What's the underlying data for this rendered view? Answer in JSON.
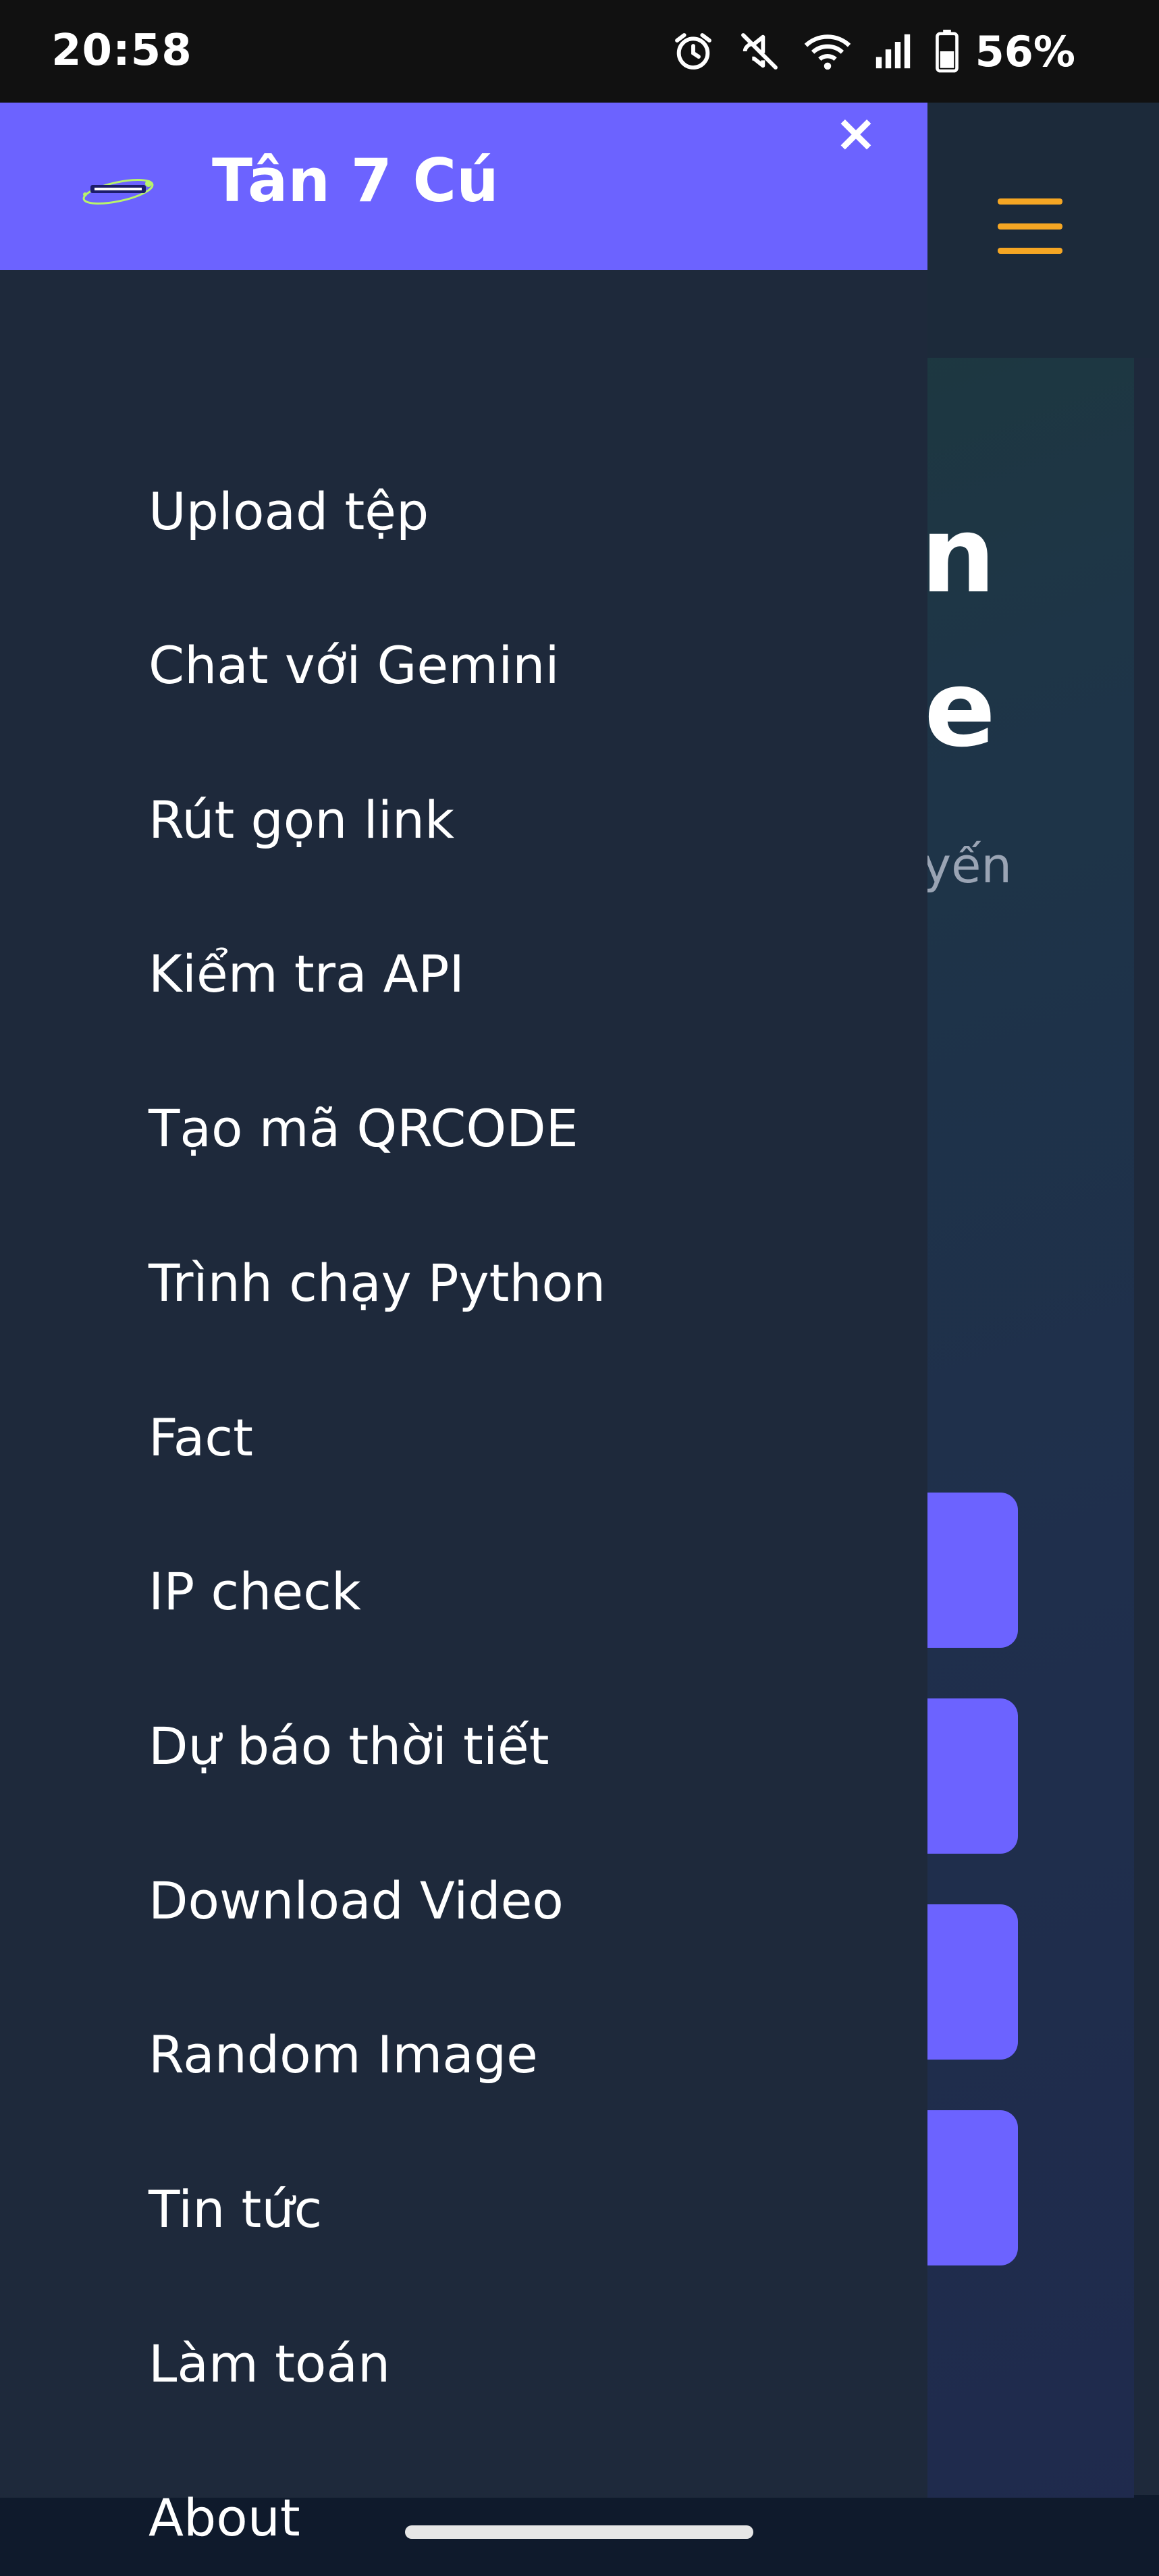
{
  "status_bar": {
    "time": "20:58",
    "battery": "56%",
    "icons": [
      "alarm-icon",
      "vibrate-off-icon",
      "wifi-icon",
      "signal-icon",
      "battery-icon"
    ]
  },
  "drawer": {
    "title": "Tân 7 Cú",
    "close_label": "×",
    "logo": "site-logo",
    "items": [
      {
        "label": "Upload tệp"
      },
      {
        "label": "Chat với Gemini"
      },
      {
        "label": "Rút gọn link"
      },
      {
        "label": "Kiểm tra API"
      },
      {
        "label": "Tạo mã QRCODE"
      },
      {
        "label": "Trình chạy Python"
      },
      {
        "label": "Fact"
      },
      {
        "label": "IP check"
      },
      {
        "label": "Dự báo thời tiết"
      },
      {
        "label": "Download Video"
      },
      {
        "label": "Random Image"
      },
      {
        "label": "Tin tức"
      },
      {
        "label": "Làm toán"
      },
      {
        "label": "About"
      }
    ]
  },
  "background": {
    "hero_title_line1": "n",
    "hero_title_line2": "e",
    "hero_subtitle": "yến"
  },
  "colors": {
    "accent": "#6c63ff",
    "drawer_bg": "#1e293b",
    "hamburger": "#f5a623"
  }
}
